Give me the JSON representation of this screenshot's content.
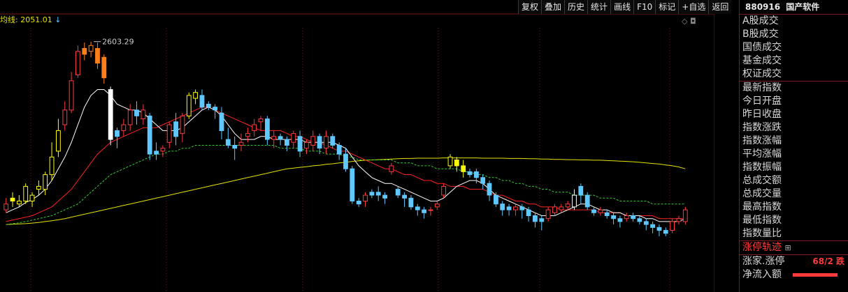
{
  "toolbar": {
    "buttons": [
      "复权",
      "叠加",
      "历史",
      "统计",
      "画线",
      "F10",
      "标记",
      "+自选",
      "返回"
    ]
  },
  "ma_label": "均线: 2051.01",
  "ma_arrow": "↓",
  "top_icons": "◇ ◘",
  "peak_label": "2603.29",
  "panel": {
    "code": "880916",
    "name": "国产软件",
    "group1": [
      "A股成交",
      "B股成交",
      "国债成交",
      "基金成交",
      "权证成交"
    ],
    "group2": [
      "最新指数",
      "今日开盘",
      "昨日收盘",
      "指数涨跌",
      "指数涨幅",
      "平均涨幅",
      "指数振幅",
      "总成交额",
      "总成交量",
      "最高指数",
      "最低指数",
      "指数量比"
    ],
    "limit_track": "涨停轨迹",
    "limit_label": "涨家.涨停",
    "limit_value": "68/2 跌",
    "inflow_label": "净流入额"
  },
  "chart_data": {
    "type": "candlestick",
    "y_axis": {
      "min": 1750,
      "max": 2700,
      "ticks": [
        1800,
        1900,
        2000,
        2100,
        2200,
        2300,
        2400,
        2500,
        2600
      ]
    },
    "peak_high": 2603.29,
    "candles": [
      [
        2030,
        2050,
        2020,
        2070
      ],
      [
        2070,
        2060,
        2040,
        2090
      ],
      [
        2050,
        2060,
        2040,
        2080
      ],
      [
        2060,
        2110,
        2050,
        2120
      ],
      [
        2060,
        2080,
        2040,
        2090
      ],
      [
        2100,
        2110,
        2080,
        2130
      ],
      [
        2100,
        2150,
        2080,
        2160
      ],
      [
        2150,
        2210,
        2130,
        2260
      ],
      [
        2230,
        2300,
        2210,
        2340
      ],
      [
        2320,
        2370,
        2300,
        2400
      ],
      [
        2370,
        2470,
        2360,
        2500
      ],
      [
        2490,
        2570,
        2480,
        2590
      ],
      [
        2580,
        2560,
        2540,
        2600
      ],
      [
        2570,
        2590,
        2550,
        2603
      ],
      [
        2580,
        2530,
        2510,
        2600
      ],
      [
        2550,
        2480,
        2460,
        2560
      ],
      [
        2440,
        2270,
        2250,
        2450
      ],
      [
        2300,
        2280,
        2240,
        2310
      ],
      [
        2300,
        2320,
        2280,
        2340
      ],
      [
        2320,
        2370,
        2300,
        2390
      ],
      [
        2370,
        2350,
        2320,
        2400
      ],
      [
        2340,
        2370,
        2320,
        2390
      ],
      [
        2350,
        2220,
        2200,
        2360
      ],
      [
        2230,
        2220,
        2200,
        2260
      ],
      [
        2230,
        2240,
        2210,
        2250
      ],
      [
        2260,
        2320,
        2240,
        2330
      ],
      [
        2330,
        2280,
        2250,
        2360
      ],
      [
        2290,
        2350,
        2260,
        2360
      ],
      [
        2350,
        2420,
        2340,
        2430
      ],
      [
        2410,
        2430,
        2390,
        2440
      ],
      [
        2420,
        2380,
        2370,
        2440
      ],
      [
        2390,
        2380,
        2370,
        2400
      ],
      [
        2380,
        2370,
        2340,
        2390
      ],
      [
        2360,
        2300,
        2270,
        2380
      ],
      [
        2270,
        2250,
        2240,
        2310
      ],
      [
        2250,
        2240,
        2200,
        2280
      ],
      [
        2250,
        2260,
        2230,
        2290
      ],
      [
        2280,
        2290,
        2260,
        2310
      ],
      [
        2300,
        2320,
        2280,
        2340
      ],
      [
        2330,
        2340,
        2300,
        2350
      ],
      [
        2340,
        2270,
        2250,
        2350
      ],
      [
        2270,
        2280,
        2240,
        2300
      ],
      [
        2280,
        2270,
        2250,
        2290
      ],
      [
        2270,
        2250,
        2230,
        2280
      ],
      [
        2260,
        2290,
        2240,
        2300
      ],
      [
        2280,
        2230,
        2210,
        2300
      ],
      [
        2240,
        2260,
        2220,
        2270
      ],
      [
        2250,
        2280,
        2230,
        2300
      ],
      [
        2280,
        2240,
        2220,
        2290
      ],
      [
        2240,
        2280,
        2220,
        2300
      ],
      [
        2280,
        2250,
        2240,
        2290
      ],
      [
        2250,
        2220,
        2200,
        2260
      ],
      [
        2220,
        2170,
        2160,
        2240
      ],
      [
        2170,
        2060,
        2050,
        2180
      ],
      [
        2060,
        2050,
        2040,
        2070
      ],
      [
        2060,
        2080,
        2040,
        2090
      ],
      [
        2090,
        2080,
        2070,
        2100
      ],
      [
        2090,
        2080,
        2060,
        2110
      ],
      [
        2080,
        2070,
        2050,
        2090
      ],
      [
        2160,
        2180,
        2150,
        2190
      ],
      [
        2100,
        2080,
        2070,
        2110
      ],
      [
        2080,
        2070,
        2040,
        2090
      ],
      [
        2070,
        2040,
        2030,
        2080
      ],
      [
        2040,
        2030,
        2010,
        2050
      ],
      [
        2030,
        2020,
        2000,
        2040
      ],
      [
        2030,
        2030,
        2010,
        2040
      ],
      [
        2040,
        2050,
        2030,
        2060
      ],
      [
        2080,
        2110,
        2070,
        2120
      ],
      [
        2180,
        2210,
        2170,
        2220
      ],
      [
        2200,
        2180,
        2160,
        2210
      ],
      [
        2180,
        2160,
        2140,
        2200
      ],
      [
        2160,
        2150,
        2140,
        2170
      ],
      [
        2160,
        2140,
        2120,
        2170
      ],
      [
        2140,
        2120,
        2100,
        2150
      ],
      [
        2120,
        2080,
        2060,
        2130
      ],
      [
        2080,
        2050,
        2040,
        2090
      ],
      [
        2050,
        2030,
        2010,
        2060
      ],
      [
        2040,
        2030,
        2010,
        2050
      ],
      [
        2030,
        2040,
        2010,
        2050
      ],
      [
        2040,
        2030,
        2000,
        2050
      ],
      [
        2030,
        2010,
        1990,
        2040
      ],
      [
        2010,
        1990,
        1970,
        2020
      ],
      [
        2000,
        1990,
        1960,
        2010
      ],
      [
        2000,
        2030,
        1990,
        2040
      ],
      [
        2020,
        2040,
        2010,
        2050
      ],
      [
        2030,
        2040,
        2020,
        2050
      ],
      [
        2040,
        2050,
        2030,
        2060
      ],
      [
        2040,
        2080,
        2030,
        2100
      ],
      [
        2110,
        2080,
        2050,
        2120
      ],
      [
        2080,
        2040,
        2030,
        2090
      ],
      [
        2030,
        2020,
        2010,
        2040
      ],
      [
        2020,
        2030,
        2010,
        2040
      ],
      [
        2020,
        2010,
        2000,
        2030
      ],
      [
        2010,
        2000,
        1980,
        2020
      ],
      [
        2000,
        1990,
        1970,
        2010
      ],
      [
        2000,
        2010,
        1990,
        2020
      ],
      [
        2010,
        2000,
        1990,
        2020
      ],
      [
        2000,
        1990,
        1980,
        2010
      ],
      [
        1990,
        1980,
        1960,
        2000
      ],
      [
        1980,
        1970,
        1950,
        1990
      ],
      [
        1970,
        1960,
        1940,
        1980
      ],
      [
        1960,
        1950,
        1940,
        1970
      ],
      [
        1960,
        1990,
        1950,
        2000
      ],
      [
        1990,
        2000,
        1980,
        2010
      ],
      [
        1990,
        2030,
        1980,
        2040
      ]
    ],
    "ma_white": [
      2020,
      2030,
      2040,
      2055,
      2065,
      2080,
      2100,
      2130,
      2170,
      2210,
      2260,
      2320,
      2380,
      2420,
      2440,
      2440,
      2420,
      2390,
      2380,
      2370,
      2370,
      2360,
      2340,
      2320,
      2300,
      2300,
      2300,
      2310,
      2330,
      2350,
      2370,
      2380,
      2370,
      2350,
      2320,
      2290,
      2270,
      2270,
      2270,
      2280,
      2280,
      2270,
      2270,
      2270,
      2270,
      2270,
      2260,
      2260,
      2260,
      2260,
      2260,
      2250,
      2240,
      2210,
      2180,
      2160,
      2140,
      2130,
      2120,
      2120,
      2110,
      2100,
      2090,
      2080,
      2070,
      2060,
      2060,
      2070,
      2090,
      2110,
      2120,
      2130,
      2130,
      2120,
      2100,
      2080,
      2070,
      2060,
      2050,
      2040,
      2030,
      2020,
      2010,
      2010,
      2010,
      2020,
      2030,
      2040,
      2050,
      2050,
      2040,
      2030,
      2030,
      2020,
      2020,
      2010,
      2010,
      2010,
      2000,
      2000,
      1990,
      1990,
      1990,
      1990,
      2000
    ],
    "ma_red": [
      1990,
      1995,
      2000,
      2005,
      2010,
      2020,
      2030,
      2040,
      2060,
      2080,
      2100,
      2130,
      2160,
      2190,
      2220,
      2240,
      2260,
      2270,
      2280,
      2290,
      2300,
      2310,
      2310,
      2310,
      2320,
      2330,
      2340,
      2350,
      2360,
      2370,
      2380,
      2380,
      2370,
      2360,
      2350,
      2340,
      2330,
      2320,
      2310,
      2300,
      2300,
      2300,
      2300,
      2290,
      2280,
      2280,
      2270,
      2260,
      2260,
      2250,
      2240,
      2230,
      2230,
      2220,
      2210,
      2200,
      2190,
      2180,
      2170,
      2170,
      2160,
      2150,
      2150,
      2140,
      2130,
      2130,
      2120,
      2120,
      2110,
      2110,
      2110,
      2100,
      2100,
      2100,
      2090,
      2080,
      2080,
      2070,
      2060,
      2060,
      2050,
      2050,
      2040,
      2040,
      2040,
      2030,
      2030,
      2030,
      2030,
      2030,
      2030,
      2020,
      2020,
      2020,
      2020,
      2010,
      2010,
      2010,
      2010,
      2010,
      2000,
      2000,
      2000,
      2000,
      2000
    ],
    "ma_green": [
      1980,
      1983,
      1986,
      1990,
      1995,
      2000,
      2005,
      2010,
      2020,
      2030,
      2040,
      2050,
      2070,
      2090,
      2110,
      2130,
      2150,
      2160,
      2170,
      2180,
      2190,
      2200,
      2210,
      2220,
      2220,
      2230,
      2230,
      2240,
      2240,
      2250,
      2250,
      2250,
      2250,
      2250,
      2250,
      2250,
      2250,
      2250,
      2250,
      2250,
      2250,
      2250,
      2240,
      2240,
      2240,
      2240,
      2230,
      2230,
      2230,
      2220,
      2220,
      2220,
      2210,
      2210,
      2200,
      2200,
      2200,
      2200,
      2200,
      2200,
      2190,
      2190,
      2190,
      2180,
      2180,
      2180,
      2170,
      2170,
      2170,
      2170,
      2160,
      2160,
      2150,
      2150,
      2140,
      2140,
      2130,
      2130,
      2120,
      2120,
      2110,
      2110,
      2100,
      2100,
      2090,
      2090,
      2090,
      2080,
      2080,
      2080,
      2080,
      2070,
      2070,
      2070,
      2060,
      2060,
      2060,
      2060,
      2060,
      2050,
      2050,
      2050,
      2050,
      2050,
      2050
    ],
    "ma_yellow": [
      1980,
      1981,
      1982,
      1983,
      1985,
      1987,
      1990,
      1993,
      1996,
      2000,
      2005,
      2010,
      2015,
      2020,
      2025,
      2030,
      2035,
      2040,
      2045,
      2050,
      2055,
      2060,
      2065,
      2070,
      2075,
      2080,
      2085,
      2090,
      2095,
      2100,
      2105,
      2110,
      2115,
      2120,
      2125,
      2130,
      2135,
      2140,
      2145,
      2150,
      2155,
      2160,
      2165,
      2170,
      2172,
      2175,
      2177,
      2180,
      2182,
      2185,
      2187,
      2190,
      2192,
      2195,
      2197,
      2199,
      2200,
      2201,
      2202,
      2203,
      2204,
      2205,
      2205,
      2206,
      2206,
      2206,
      2206,
      2207,
      2207,
      2207,
      2207,
      2207,
      2207,
      2206,
      2206,
      2206,
      2206,
      2205,
      2205,
      2205,
      2204,
      2204,
      2203,
      2203,
      2202,
      2202,
      2201,
      2201,
      2200,
      2200,
      2199,
      2199,
      2198,
      2197,
      2196,
      2195,
      2194,
      2192,
      2190,
      2188,
      2186,
      2183,
      2180,
      2176,
      2170
    ]
  },
  "colors": {
    "up": "#ff3b3b",
    "down": "#5ec8ff",
    "ma_white": "#ffffff",
    "ma_red": "#ff2020",
    "ma_green": "#33cc33",
    "ma_yellow": "#e4e400",
    "grid": "#7a1a1a",
    "highlight_yellow": "#ffff00",
    "highlight_orange": "#ff7f1a"
  }
}
